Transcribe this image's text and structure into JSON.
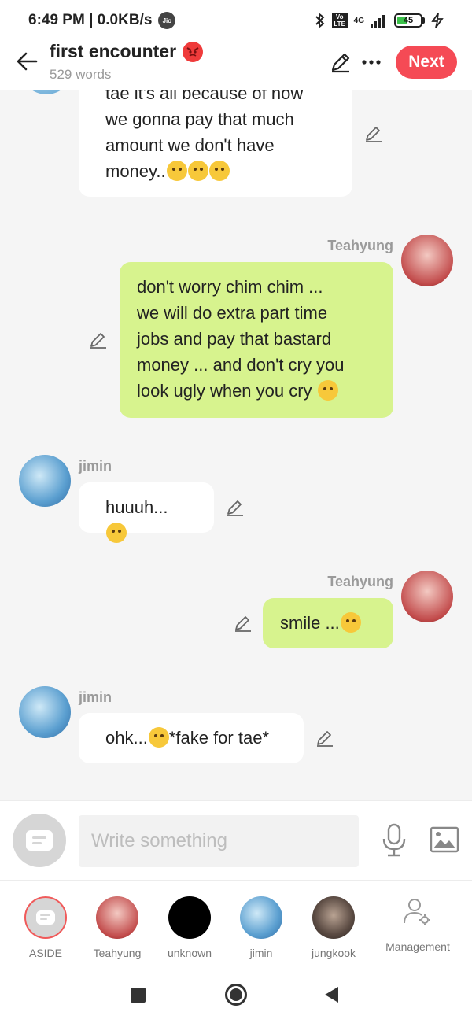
{
  "status_bar": {
    "time_speed": "6:49 PM | 0.0KB/s",
    "carrier_badge": "Jio",
    "network": "4G",
    "volte": "Vo LTE",
    "battery": "45",
    "battery_level": 0.45
  },
  "header": {
    "title": "first encounter",
    "word_count": "529 words",
    "next_label": "Next",
    "icons": [
      "back-arrow-icon",
      "angry-face-emoji-icon",
      "pencil-icon",
      "more-icon"
    ]
  },
  "messages": [
    {
      "sender": "jimin",
      "side": "left",
      "lines": [
        "tae it's all because of how",
        "we gonna pay that much",
        "amount we don't have",
        "money.."
      ],
      "emoji_count": 3
    },
    {
      "sender": "Teahyung",
      "side": "right",
      "lines": [
        "don't worry chim chim ...",
        "we will do extra part time",
        "jobs and pay that bastard",
        "money ... and don't cry you",
        "look ugly when you cry"
      ],
      "emoji_count": 1
    },
    {
      "sender": "jimin",
      "side": "left",
      "lines": [
        "huuuh..."
      ],
      "emoji_count": 1
    },
    {
      "sender": "Teahyung",
      "side": "right",
      "lines": [
        "smile ..."
      ],
      "emoji_count": 1
    },
    {
      "sender": "jimin",
      "side": "left",
      "text_before": "ohk...",
      "text_after": "*fake for tae*",
      "emoji_count": 1
    }
  ],
  "composer": {
    "placeholder": "Write something"
  },
  "characters": [
    {
      "label": "ASIDE"
    },
    {
      "label": "Teahyung"
    },
    {
      "label": "unknown"
    },
    {
      "label": "jimin"
    },
    {
      "label": "jungkook"
    },
    {
      "label": "Management"
    }
  ],
  "colors": {
    "accent": "#f54a55",
    "own_bubble": "#d7f38e",
    "other_bubble": "#ffffff",
    "background": "#f5f5f5"
  }
}
